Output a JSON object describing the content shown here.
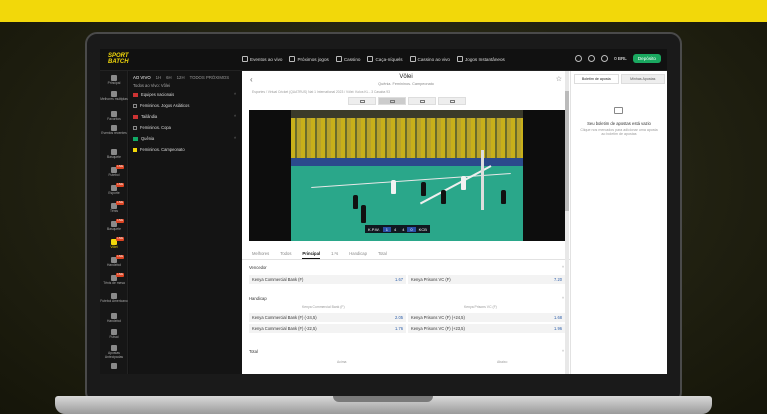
{
  "brand": {
    "logo_line1": "SPORT",
    "logo_line2": "BATCH",
    "accent": "#f2d80a",
    "cta_color": "#1aa860"
  },
  "topnav": [
    {
      "label": "Eventos ao vivo",
      "icon": "tv-icon"
    },
    {
      "label": "Próximos jogos",
      "icon": "calendar-icon"
    },
    {
      "label": "Cassino",
      "icon": "cherry-icon"
    },
    {
      "label": "Caça-níquels",
      "icon": "slot-icon"
    },
    {
      "label": "Cassino ao vivo",
      "icon": "cards-icon"
    },
    {
      "label": "Jogos Instantâneos",
      "icon": "rocket-icon"
    }
  ],
  "account": {
    "balance": "0 BRL",
    "deposit_label": "Depósito"
  },
  "rail": [
    {
      "label": "Principal",
      "active": false
    },
    {
      "label": "Melhores multiplas",
      "active": false
    },
    {
      "label": "Favoritos",
      "active": false
    },
    {
      "label": "Eventos recentes",
      "active": false
    },
    {
      "label": "Basquete",
      "active": false
    },
    {
      "label": "Futebol",
      "active": false
    },
    {
      "label": "Esporte",
      "active": false
    },
    {
      "label": "Tênis",
      "active": false
    },
    {
      "label": "Basquete",
      "active": false
    },
    {
      "label": "Vôlei",
      "active": true
    },
    {
      "label": "Handebol",
      "active": false
    },
    {
      "label": "Tênis de mesa",
      "active": false
    },
    {
      "label": "Futebol Americano",
      "active": false
    },
    {
      "label": "Handebol",
      "active": false
    },
    {
      "label": "Futsal",
      "active": false
    },
    {
      "label": "Apostas Antecipadas",
      "active": false
    },
    {
      "label": "",
      "active": false
    }
  ],
  "left_panel": {
    "tabs": [
      "AO VIVO",
      "1H",
      "6H",
      "12H",
      "TODOS PRÓXIMOS"
    ],
    "all_label": "Todos ao Vivo: Vôlei",
    "sections": [
      {
        "label": "Equipes nacionais",
        "flag": "red",
        "type": "header"
      },
      {
        "label": "Femininos. Jogos Asiáticos",
        "type": "item"
      },
      {
        "label": "Tailândia",
        "flag": "red",
        "type": "header"
      },
      {
        "label": "Femininos. Copa",
        "type": "item"
      },
      {
        "label": "Quênia",
        "flag": "green",
        "type": "header"
      },
      {
        "label": "Femininos. Campeonato",
        "type": "item-checked"
      }
    ]
  },
  "match": {
    "title": "Vôlei",
    "subtitle": "Quênia. Femininos. Campeonato",
    "breadcrumb": "Esportes  /  Virtual Cricket (QUATRUS) Nat 1 International 2023  /  Vôlei: Kolos KL - 3 Casaba 93",
    "scoreboard": {
      "home": "K.P.W.",
      "home_set": "1",
      "home_pts": "4",
      "away_pts": "4",
      "away_set": "0",
      "away": "KCB"
    }
  },
  "market_tabs": [
    "Melhores",
    "Todos",
    "Principal",
    "1.ºs",
    "Handicap",
    "Total"
  ],
  "market_tab_active": 2,
  "markets": {
    "winner": {
      "title": "Vencedor",
      "rows": [
        {
          "left": "Kenya Commercial Bank (F)",
          "left_odd": "1.67",
          "right": "Kenya Prisons VC (F)",
          "right_odd": "7.20"
        }
      ]
    },
    "handicap": {
      "title": "Handicap",
      "col_left": "Kenya Commercial Bank (F)",
      "col_right": "Kenya Prisons VC (F)",
      "rows": [
        {
          "left": "Kenya Commercial Bank (F) (-24,5)",
          "left_odd": "2.05",
          "right": "Kenya Prisons VC (F) (+24,5)",
          "right_odd": "1.68"
        },
        {
          "left": "Kenya Commercial Bank (F) (-22,5)",
          "left_odd": "1.76",
          "right": "Kenya Prisons VC (F) (+23,5)",
          "right_odd": "1.96"
        }
      ]
    },
    "total": {
      "title": "Total",
      "col_left": "Acima",
      "col_right": "Abaixo"
    }
  },
  "betslip": {
    "tab1": "Boletim de aposta",
    "tab2": "Minhas Apostas",
    "empty_title": "Seu boletim de apostas está vazio",
    "empty_hint": "Clique nos mercados para adicionar uma aposta ao boletim de apostas"
  }
}
